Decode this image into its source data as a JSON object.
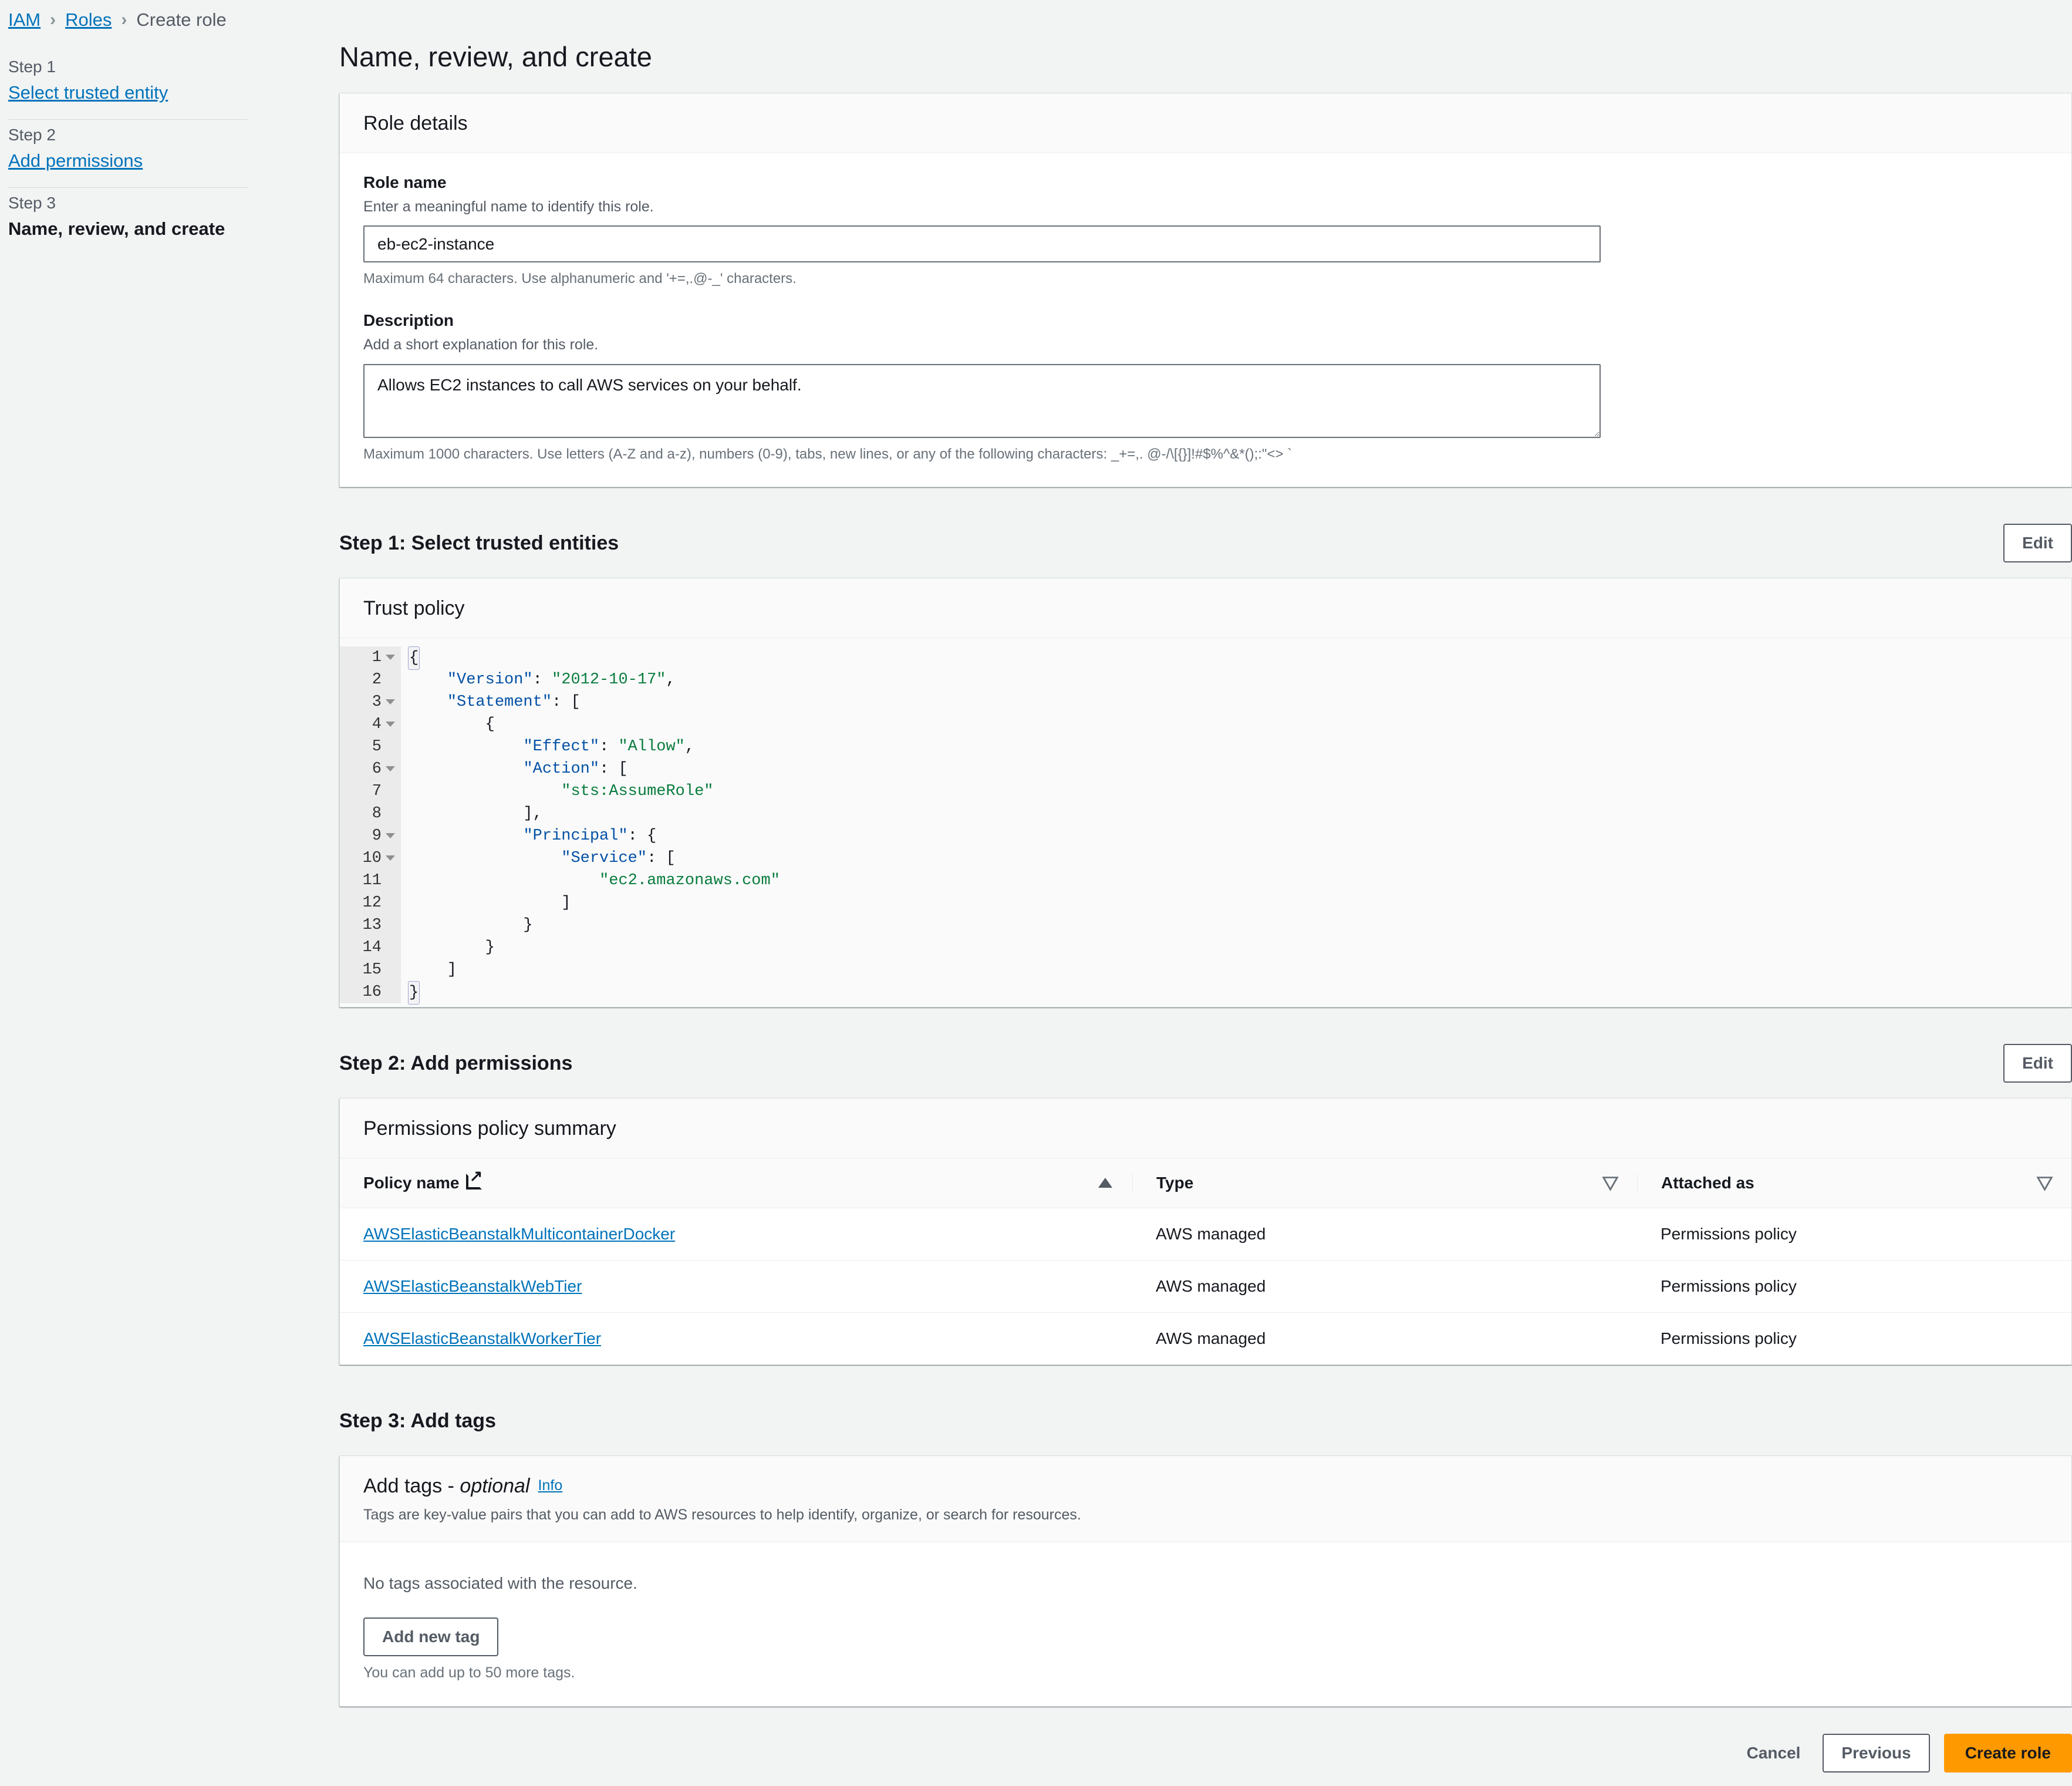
{
  "breadcrumb": {
    "items": [
      {
        "label": "IAM",
        "link": true
      },
      {
        "label": "Roles",
        "link": true
      },
      {
        "label": "Create role",
        "link": false
      }
    ],
    "separator": "›"
  },
  "sidebar": {
    "steps": [
      {
        "number": "Step 1",
        "label": "Select trusted entity",
        "active": false
      },
      {
        "number": "Step 2",
        "label": "Add permissions",
        "active": false
      },
      {
        "number": "Step 3",
        "label": "Name, review, and create",
        "active": true
      }
    ]
  },
  "page": {
    "title": "Name, review, and create"
  },
  "role_details": {
    "card_title": "Role details",
    "role_name": {
      "label": "Role name",
      "description": "Enter a meaningful name to identify this role.",
      "value": "eb-ec2-instance",
      "hint": "Maximum 64 characters. Use alphanumeric and '+=,.@-_' characters."
    },
    "description_field": {
      "label": "Description",
      "description": "Add a short explanation for this role.",
      "value": "Allows EC2 instances to call AWS services on your behalf.",
      "hint": "Maximum 1000 characters. Use letters (A-Z and a-z), numbers (0-9), tabs, new lines, or any of the following characters: _+=,. @-/\\[{}]!#$%^&*();:\"<> `"
    }
  },
  "step1": {
    "heading": "Step 1: Select trusted entities",
    "edit_label": "Edit",
    "card_title": "Trust policy",
    "code_lines": [
      {
        "n": "1",
        "fold": true,
        "segments": [
          {
            "t": "{",
            "c": "brace"
          }
        ]
      },
      {
        "n": "2",
        "fold": false,
        "segments": [
          {
            "t": "    ",
            "c": "p"
          },
          {
            "t": "\"Version\"",
            "c": "k"
          },
          {
            "t": ": ",
            "c": "p"
          },
          {
            "t": "\"2012-10-17\"",
            "c": "s"
          },
          {
            "t": ",",
            "c": "p"
          }
        ]
      },
      {
        "n": "3",
        "fold": true,
        "segments": [
          {
            "t": "    ",
            "c": "p"
          },
          {
            "t": "\"Statement\"",
            "c": "k"
          },
          {
            "t": ": [",
            "c": "p"
          }
        ]
      },
      {
        "n": "4",
        "fold": true,
        "segments": [
          {
            "t": "        {",
            "c": "p"
          }
        ]
      },
      {
        "n": "5",
        "fold": false,
        "segments": [
          {
            "t": "            ",
            "c": "p"
          },
          {
            "t": "\"Effect\"",
            "c": "k"
          },
          {
            "t": ": ",
            "c": "p"
          },
          {
            "t": "\"Allow\"",
            "c": "s"
          },
          {
            "t": ",",
            "c": "p"
          }
        ]
      },
      {
        "n": "6",
        "fold": true,
        "segments": [
          {
            "t": "            ",
            "c": "p"
          },
          {
            "t": "\"Action\"",
            "c": "k"
          },
          {
            "t": ": [",
            "c": "p"
          }
        ]
      },
      {
        "n": "7",
        "fold": false,
        "segments": [
          {
            "t": "                ",
            "c": "p"
          },
          {
            "t": "\"sts:AssumeRole\"",
            "c": "s"
          }
        ]
      },
      {
        "n": "8",
        "fold": false,
        "segments": [
          {
            "t": "            ],",
            "c": "p"
          }
        ]
      },
      {
        "n": "9",
        "fold": true,
        "segments": [
          {
            "t": "            ",
            "c": "p"
          },
          {
            "t": "\"Principal\"",
            "c": "k"
          },
          {
            "t": ": {",
            "c": "p"
          }
        ]
      },
      {
        "n": "10",
        "fold": true,
        "segments": [
          {
            "t": "                ",
            "c": "p"
          },
          {
            "t": "\"Service\"",
            "c": "k"
          },
          {
            "t": ": [",
            "c": "p"
          }
        ]
      },
      {
        "n": "11",
        "fold": false,
        "segments": [
          {
            "t": "                    ",
            "c": "p"
          },
          {
            "t": "\"ec2.amazonaws.com\"",
            "c": "s"
          }
        ]
      },
      {
        "n": "12",
        "fold": false,
        "segments": [
          {
            "t": "                ]",
            "c": "p"
          }
        ]
      },
      {
        "n": "13",
        "fold": false,
        "segments": [
          {
            "t": "            }",
            "c": "p"
          }
        ]
      },
      {
        "n": "14",
        "fold": false,
        "segments": [
          {
            "t": "        }",
            "c": "p"
          }
        ]
      },
      {
        "n": "15",
        "fold": false,
        "segments": [
          {
            "t": "    ]",
            "c": "p"
          }
        ]
      },
      {
        "n": "16",
        "fold": false,
        "segments": [
          {
            "t": "}",
            "c": "brace"
          }
        ]
      }
    ]
  },
  "step2": {
    "heading": "Step 2: Add permissions",
    "edit_label": "Edit",
    "card_title": "Permissions policy summary",
    "table": {
      "columns": [
        {
          "label": "Policy name",
          "icon": "external-link-icon",
          "sort": "asc"
        },
        {
          "label": "Type",
          "icon": null,
          "sort": "none"
        },
        {
          "label": "Attached as",
          "icon": null,
          "sort": "none"
        }
      ],
      "rows": [
        {
          "policy_name": "AWSElasticBeanstalkMulticontainerDocker",
          "type": "AWS managed",
          "attached_as": "Permissions policy"
        },
        {
          "policy_name": "AWSElasticBeanstalkWebTier",
          "type": "AWS managed",
          "attached_as": "Permissions policy"
        },
        {
          "policy_name": "AWSElasticBeanstalkWorkerTier",
          "type": "AWS managed",
          "attached_as": "Permissions policy"
        }
      ]
    }
  },
  "step3": {
    "heading": "Step 3: Add tags",
    "card_title": "Add tags - ",
    "card_title_optional": "optional",
    "info_label": "Info",
    "card_sub": "Tags are key-value pairs that you can add to AWS resources to help identify, organize, or search for resources.",
    "empty_text": "No tags associated with the resource.",
    "add_tag_label": "Add new tag",
    "note": "You can add up to 50 more tags."
  },
  "footer": {
    "cancel_label": "Cancel",
    "previous_label": "Previous",
    "create_label": "Create role"
  },
  "colors": {
    "accent_link": "#0073bb",
    "primary_button": "#ff9900",
    "page_background": "#f2f3f3",
    "json_key": "#0451a5",
    "json_string": "#0a7c3e"
  }
}
